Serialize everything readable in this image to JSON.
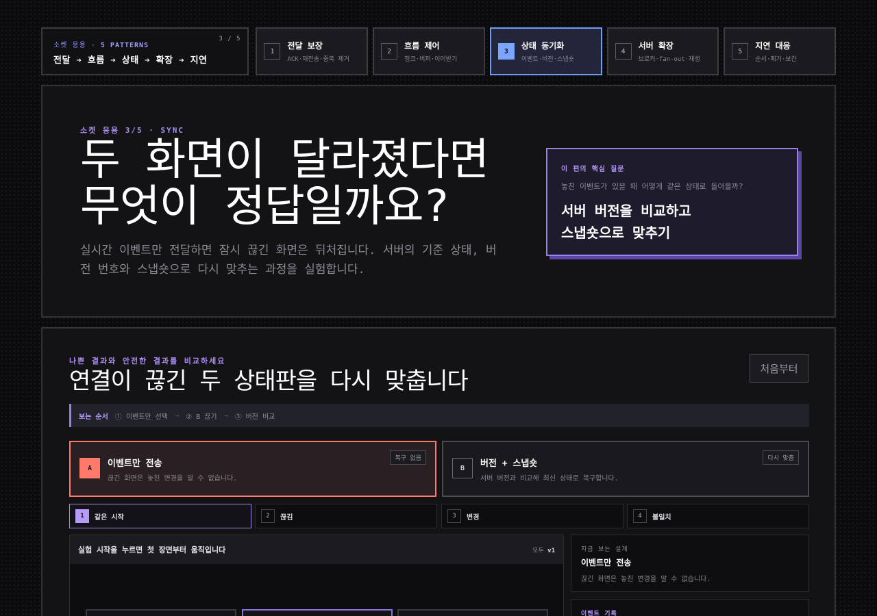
{
  "nav": {
    "series": {
      "eyebrow_prefix": "소켓 응용 · ",
      "eyebrow_strong": "5 PATTERNS",
      "flow": "전달 ➔ 흐름 ➔ 상태 ➔ 확장 ➔ 지연",
      "count": "3 / 5"
    },
    "steps": [
      {
        "num": "1",
        "title": "전달 보장",
        "sub": "ACK·재전송·중복 제거"
      },
      {
        "num": "2",
        "title": "흐름 제어",
        "sub": "청크·버퍼·이어받기"
      },
      {
        "num": "3",
        "title": "상태 동기화",
        "sub": "이벤트·버전·스냅숏"
      },
      {
        "num": "4",
        "title": "서버 확장",
        "sub": "브로커·fan-out·재생"
      },
      {
        "num": "5",
        "title": "지연 대응",
        "sub": "순서·폐기·보간"
      }
    ],
    "active_step": "3",
    "accent_color": "#7aa6ff"
  },
  "hero": {
    "kicker": "소켓 응용 3/5 · SYNC",
    "title_line1": "두 화면이 달라졌다면",
    "title_line2": "무엇이 정답일까요?",
    "description": "실시간 이벤트만 전달하면 잠시 끊긴 화면은 뒤처집니다. 서버의 기준 상태, 버전 번호와 스냅숏으로 다시 맞추는 과정을 실험합니다.",
    "question_card": {
      "label": "이 편의 핵심 질문",
      "question": "놓친 이벤트가 있을 때 어떻게 같은 상태로 돌아올까?",
      "answer_line1": "서버 버전을 비교하고",
      "answer_line2": "스냅숏으로 맞추기"
    }
  },
  "lab": {
    "kicker": "나쁜 결과와 안전한 결과를 비교하세요",
    "title": "연결이 끊긴 두 상태판을 다시 맞춥니다",
    "reset_label": "처음부터",
    "guide": {
      "label": "보는 순서",
      "steps": [
        "① 이벤트만 선택",
        "② B 끊기",
        "③ 버전 비교"
      ],
      "arrow": "→"
    },
    "choices": [
      {
        "badge": "A",
        "title": "이벤트만 전송",
        "sub": "끊긴 화면은 놓친 변경을 알 수 없습니다.",
        "tag": "복구 없음"
      },
      {
        "badge": "B",
        "title": "버전 + 스냅숏",
        "sub": "서버 버전과 비교해 최신 상태로 복구합니다.",
        "tag": "다시 맞춤"
      }
    ],
    "scenarios": [
      {
        "num": "1",
        "label": "같은 시작"
      },
      {
        "num": "2",
        "label": "끊김"
      },
      {
        "num": "3",
        "label": "변경"
      },
      {
        "num": "4",
        "label": "불일치"
      }
    ],
    "stage": {
      "title": "실험 시작을 누르면 첫 장면부터 움직입니다",
      "version_prefix": "모두",
      "version": "v1"
    },
    "design_panel": {
      "label": "지금 보는 설계",
      "title": "이벤트만 전송",
      "sub": "끊긴 화면은 놓친 변경을 알 수 없습니다."
    },
    "log_panel": {
      "label": "이벤트 기록"
    },
    "colors": {
      "choice_a": "#ff7a6a",
      "purple_accent": "#a98cf0"
    }
  }
}
